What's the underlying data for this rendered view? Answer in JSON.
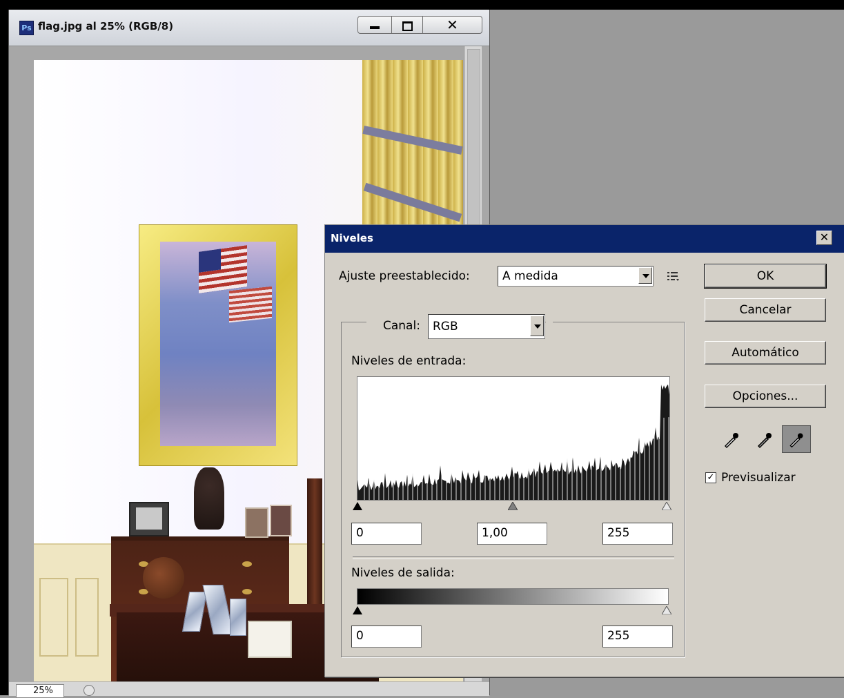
{
  "document_window": {
    "app_icon": "Ps",
    "title": "flag.jpg al 25% (RGB/8)",
    "zoom": "25%",
    "controls": {
      "minimize": "minimize-icon",
      "maximize": "maximize-icon",
      "close_glyph": "✕"
    }
  },
  "levels_dialog": {
    "title": "Niveles",
    "close_glyph": "✕",
    "preset_label": "Ajuste preestablecido:",
    "preset_value": "A medida",
    "channel_label": "Canal:",
    "channel_value": "RGB",
    "input_levels_label": "Niveles de entrada:",
    "input_black": "0",
    "input_gamma": "1,00",
    "input_white": "255",
    "output_levels_label": "Niveles de salida:",
    "output_black": "0",
    "output_white": "255",
    "buttons": {
      "ok": "OK",
      "cancel": "Cancelar",
      "auto": "Automático",
      "options": "Opciones..."
    },
    "eyedroppers": [
      "black-point-eyedropper-icon",
      "gray-point-eyedropper-icon",
      "white-point-eyedropper-icon"
    ],
    "preview_label": "Previsualizar",
    "preview_checked": true,
    "check_glyph": "✓"
  }
}
